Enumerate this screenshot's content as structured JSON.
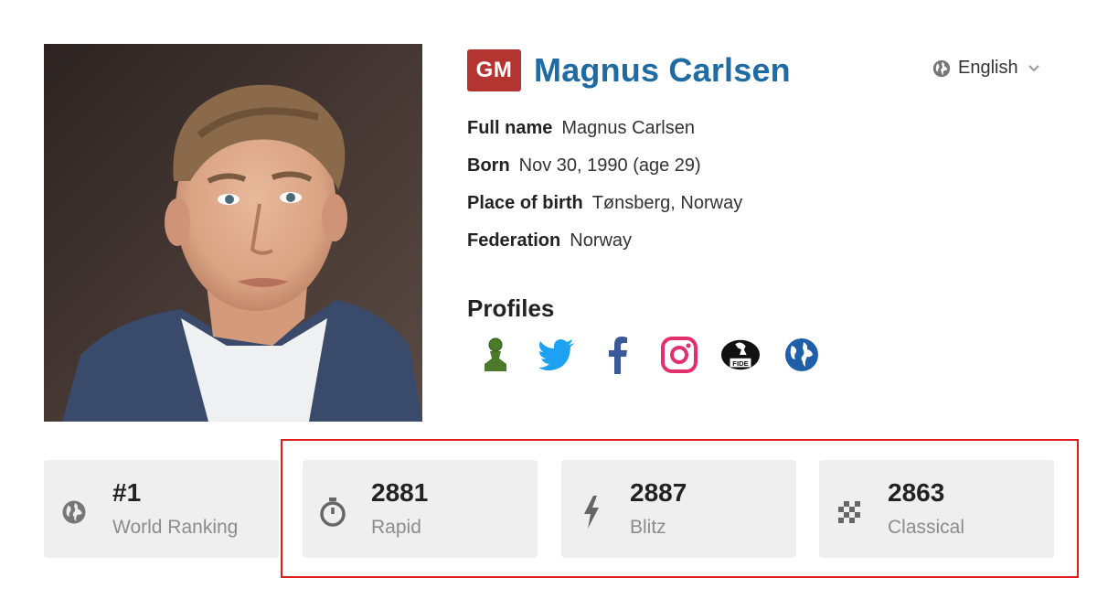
{
  "player": {
    "title": "GM",
    "name": "Magnus Carlsen"
  },
  "language": {
    "label": "English",
    "icon": "globe-icon"
  },
  "facts": [
    {
      "label": "Full name",
      "value": "Magnus Carlsen"
    },
    {
      "label": "Born",
      "value": "Nov 30, 1990 (age 29)"
    },
    {
      "label": "Place of birth",
      "value": "Tønsberg, Norway"
    },
    {
      "label": "Federation",
      "value": "Norway"
    }
  ],
  "profiles": {
    "heading": "Profiles",
    "links": [
      {
        "icon": "chess-com-pawn-icon",
        "color": "#4a7a2a"
      },
      {
        "icon": "twitter-icon",
        "color": "#1da1f2"
      },
      {
        "icon": "facebook-icon",
        "color": "#3b5998"
      },
      {
        "icon": "instagram-icon",
        "color": "#e1306c"
      },
      {
        "icon": "fide-icon",
        "color": "#111111"
      },
      {
        "icon": "website-globe-icon",
        "color": "#1f5fa8"
      }
    ]
  },
  "stats": [
    {
      "value": "#1",
      "label": "World Ranking",
      "icon": "globe-icon"
    },
    {
      "value": "2881",
      "label": "Rapid",
      "icon": "stopwatch-icon"
    },
    {
      "value": "2887",
      "label": "Blitz",
      "icon": "lightning-icon"
    },
    {
      "value": "2863",
      "label": "Classical",
      "icon": "chessboard-icon"
    }
  ],
  "colors": {
    "title_badge": "#b33430",
    "name": "#1f6ba3",
    "stat_bg": "#efefef",
    "highlight": "#e01b1b"
  }
}
